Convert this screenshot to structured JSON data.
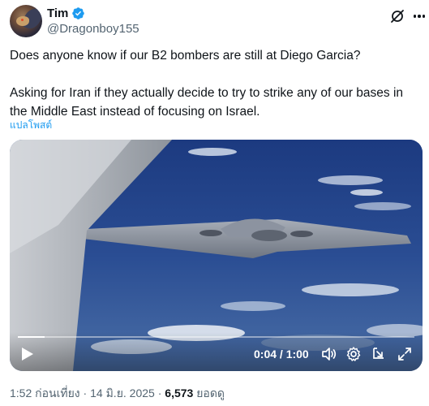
{
  "author": {
    "display_name": "Tim",
    "handle": "@Dragonboy155",
    "verified": true
  },
  "tweet": {
    "paragraph_1": "Does anyone know if our B2 bombers are still at Diego Garcia?",
    "paragraph_2": "Asking for Iran if they actually decide to try to strike any of our bases in the Middle East instead of focusing on Israel.",
    "translate_label": "แปลโพสต์"
  },
  "video": {
    "current_time": "0:04",
    "duration": "1:00",
    "time_label": "0:04 / 1:00",
    "progress": 0.067
  },
  "meta": {
    "time": "1:52 ก่อนเที่ยง",
    "separator": " · ",
    "date": "14 มิ.ย. 2025",
    "views_count": "6,573",
    "views_label": "ยอดดู"
  },
  "icons": {
    "verified": "verified-badge-icon",
    "grok": "grok-icon",
    "more": "more-icon",
    "play": "play-icon",
    "volume": "volume-icon",
    "settings": "settings-gear-icon",
    "pip": "picture-in-picture-icon",
    "fullscreen": "fullscreen-icon"
  },
  "colors": {
    "accent": "#1d9bf0",
    "text": "#0f1419",
    "secondary": "#536471"
  }
}
